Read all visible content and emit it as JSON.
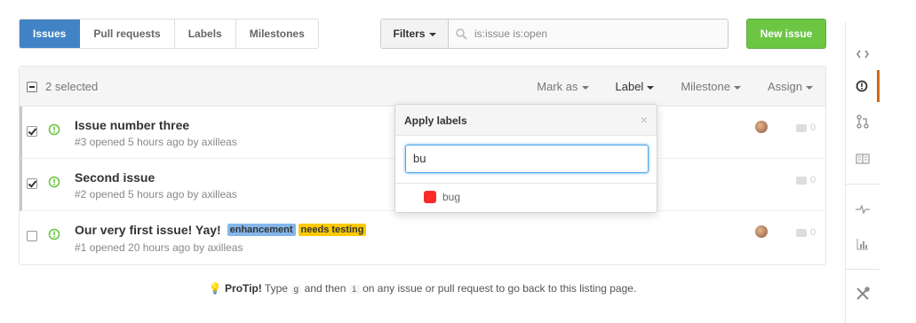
{
  "nav": {
    "tabs": [
      {
        "label": "Issues",
        "active": true
      },
      {
        "label": "Pull requests"
      },
      {
        "label": "Labels"
      },
      {
        "label": "Milestones"
      }
    ]
  },
  "search": {
    "filters_label": "Filters",
    "query": "is:issue is:open"
  },
  "new_issue_label": "New issue",
  "list": {
    "selected_text": "2 selected",
    "actions": [
      "Mark as",
      "Label",
      "Milestone",
      "Assign"
    ],
    "issues": [
      {
        "title": "Issue number three",
        "meta": "#3 opened 5 hours ago by axilleas",
        "checked": true,
        "comments": "0"
      },
      {
        "title": "Second issue",
        "meta": "#2 opened 5 hours ago by axilleas",
        "checked": true,
        "comments": "0"
      },
      {
        "title": "Our very first issue! Yay!",
        "meta": "#1 opened 20 hours ago by axilleas",
        "checked": false,
        "comments": "0",
        "labels": [
          {
            "name": "enhancement",
            "color": "#84b6eb"
          },
          {
            "name": "needs testing",
            "color": "#fbca04"
          }
        ]
      }
    ]
  },
  "label_popup": {
    "title": "Apply labels",
    "close": "×",
    "input_value": "bu",
    "options": [
      {
        "name": "bug",
        "color": "#fc2929"
      }
    ]
  },
  "protip": {
    "strong": "ProTip!",
    "text_1": "Type",
    "key_1": "g",
    "text_2": "and then",
    "key_2": "i",
    "text_3": "on any issue or pull request to go back to this listing page."
  },
  "colors": {
    "accent": "#4183c4",
    "new_issue": "#6cc644",
    "open_icon": "#6cc644",
    "sidebar_active": "#d26911"
  },
  "sidebar_icons": [
    "code-icon",
    "issue-opened-icon",
    "git-pull-request-icon",
    "book-icon",
    "pulse-icon",
    "graph-icon",
    "tools-icon"
  ]
}
